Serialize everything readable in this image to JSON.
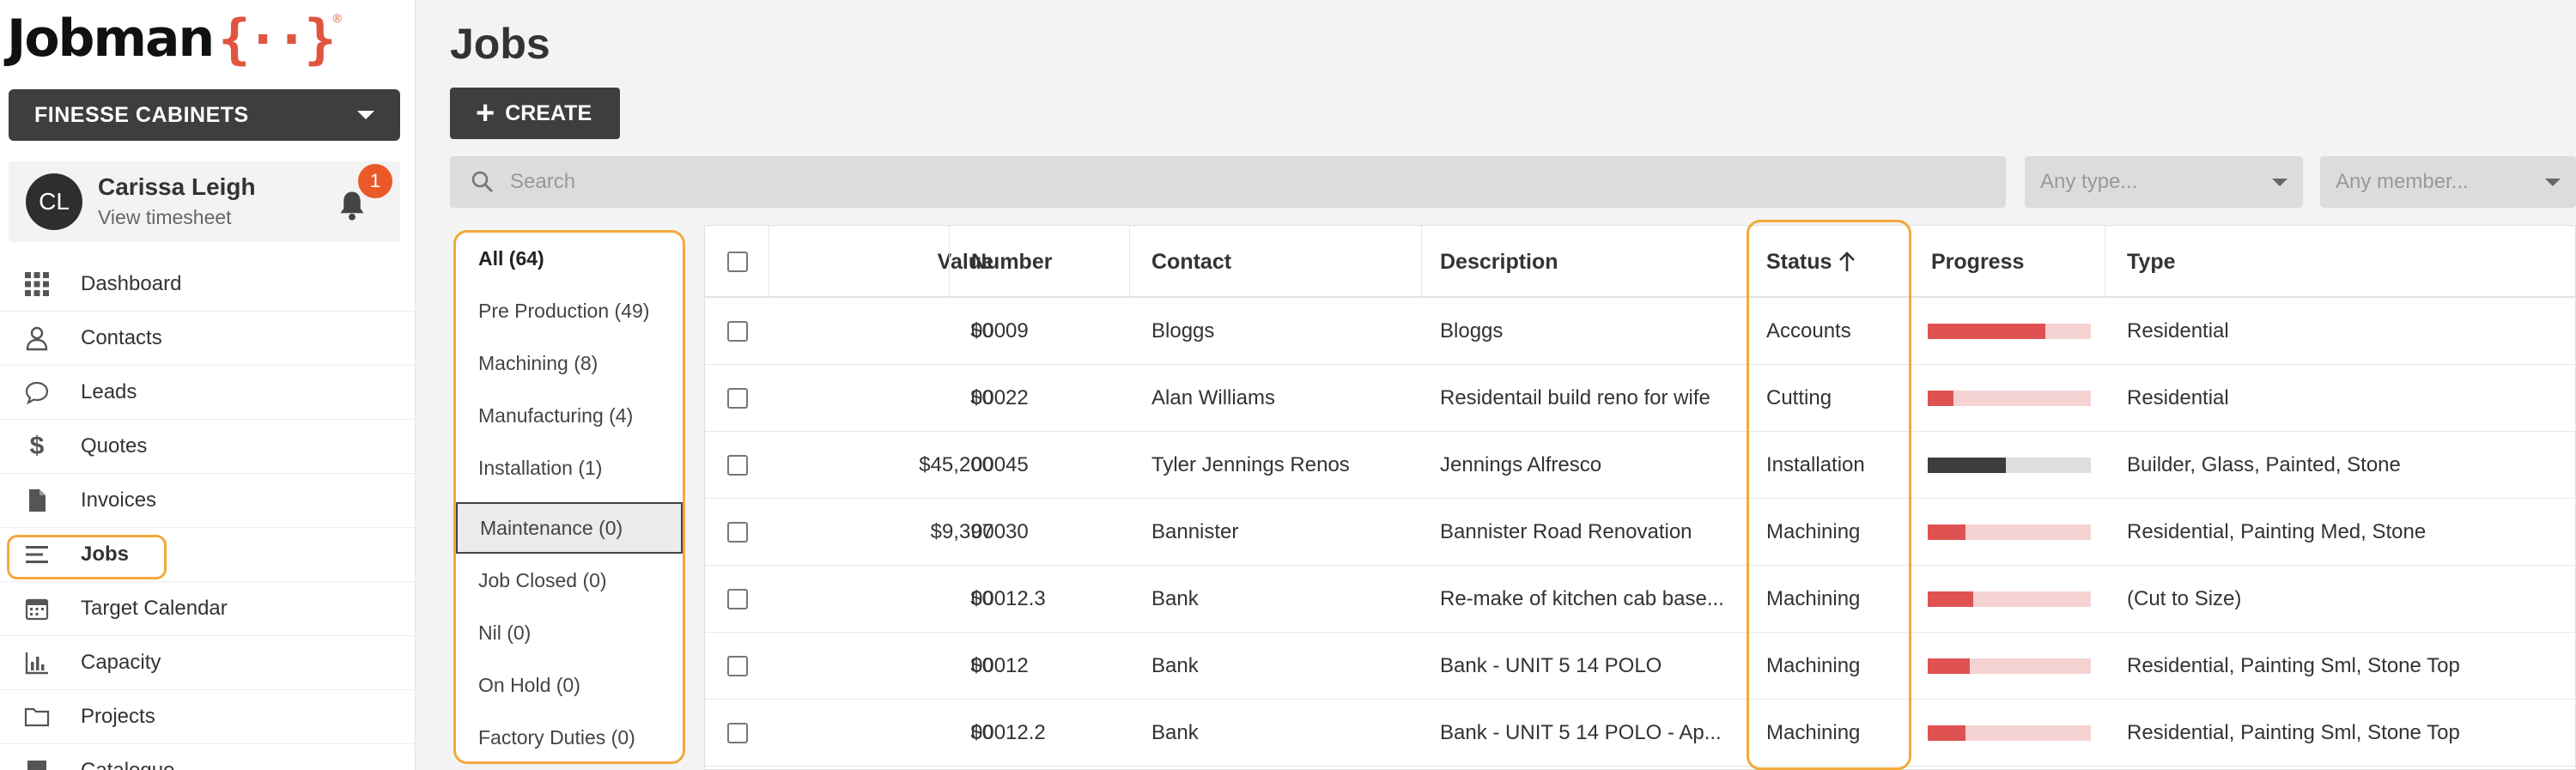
{
  "app": {
    "logo_text": "Jobman",
    "logo_mark": "{··}",
    "logo_reg": "®",
    "company": "FINESSE CABINETS"
  },
  "user": {
    "initials": "CL",
    "name": "Carissa Leigh",
    "link": "View timesheet",
    "notifications": "1"
  },
  "nav": [
    {
      "label": "Dashboard",
      "icon": "grid-icon"
    },
    {
      "label": "Contacts",
      "icon": "person-icon"
    },
    {
      "label": "Leads",
      "icon": "chat-bubble-icon"
    },
    {
      "label": "Quotes",
      "icon": "dollar-icon"
    },
    {
      "label": "Invoices",
      "icon": "document-icon"
    },
    {
      "label": "Jobs",
      "icon": "list-icon",
      "active": true
    },
    {
      "label": "Target Calendar",
      "icon": "calendar-icon"
    },
    {
      "label": "Capacity",
      "icon": "bar-chart-icon"
    },
    {
      "label": "Projects",
      "icon": "folder-icon"
    },
    {
      "label": "Catalogue",
      "icon": "book-icon"
    }
  ],
  "page": {
    "title": "Jobs",
    "create_label": "CREATE",
    "search_placeholder": "Search",
    "type_placeholder": "Any type...",
    "member_placeholder": "Any member..."
  },
  "filters": [
    {
      "label": "All (64)",
      "bold": true
    },
    {
      "label": "Pre Production (49)"
    },
    {
      "label": "Machining (8)"
    },
    {
      "label": "Manufacturing (4)"
    },
    {
      "label": "Installation (1)"
    },
    {
      "label": "Maintenance (0)",
      "hovered": true
    },
    {
      "label": "Job Closed (0)"
    },
    {
      "label": "Nil (0)"
    },
    {
      "label": "On Hold (0)"
    },
    {
      "label": "Factory Duties (0)"
    }
  ],
  "table": {
    "headers": {
      "value": "Value",
      "number": "Number",
      "contact": "Contact",
      "description": "Description",
      "status": "Status",
      "progress": "Progress",
      "type": "Type"
    },
    "sort_icon": "arrow-up-icon",
    "rows": [
      {
        "value": "$0",
        "number": "00009",
        "contact": "Bloggs",
        "description": "Bloggs",
        "status": "Accounts",
        "progress": 0.72,
        "bar_color": "#e05252",
        "track_color": "#f6d3d3",
        "type": "Residential"
      },
      {
        "value": "$0",
        "number": "00022",
        "contact": "Alan Williams",
        "description": "Residentail build reno for wife",
        "status": "Cutting",
        "progress": 0.16,
        "bar_color": "#e05252",
        "track_color": "#f6d3d3",
        "type": "Residential"
      },
      {
        "value": "$45,200",
        "number": "00045",
        "contact": "Tyler Jennings Renos",
        "description": "Jennings Alfresco",
        "status": "Installation",
        "progress": 0.48,
        "bar_color": "#3d3d3d",
        "track_color": "#dedede",
        "type": "Builder, Glass, Painted, Stone"
      },
      {
        "value": "$9,397",
        "number": "00030",
        "contact": "Bannister",
        "description": "Bannister Road Renovation",
        "status": "Machining",
        "progress": 0.23,
        "bar_color": "#e05252",
        "track_color": "#f6d3d3",
        "type": "Residential, Painting Med, Stone"
      },
      {
        "value": "$0",
        "number": "00012.3",
        "contact": "Bank",
        "description": "Re-make of kitchen cab base...",
        "status": "Machining",
        "progress": 0.28,
        "bar_color": "#e05252",
        "track_color": "#f6d3d3",
        "type": "(Cut to Size)"
      },
      {
        "value": "$0",
        "number": "00012",
        "contact": "Bank",
        "description": "Bank - UNIT 5 14 POLO",
        "status": "Machining",
        "progress": 0.26,
        "bar_color": "#e05252",
        "track_color": "#f6d3d3",
        "type": "Residential, Painting Sml, Stone Top"
      },
      {
        "value": "$0",
        "number": "00012.2",
        "contact": "Bank",
        "description": "Bank - UNIT 5 14 POLO - Ap...",
        "status": "Machining",
        "progress": 0.23,
        "bar_color": "#e05252",
        "track_color": "#f6d3d3",
        "type": "Residential, Painting Sml, Stone Top"
      }
    ]
  },
  "colors": {
    "accent": "#f2a93b",
    "badge": "#ea5a28",
    "brand": "#e05540",
    "dark_button": "#3e3e3e"
  }
}
